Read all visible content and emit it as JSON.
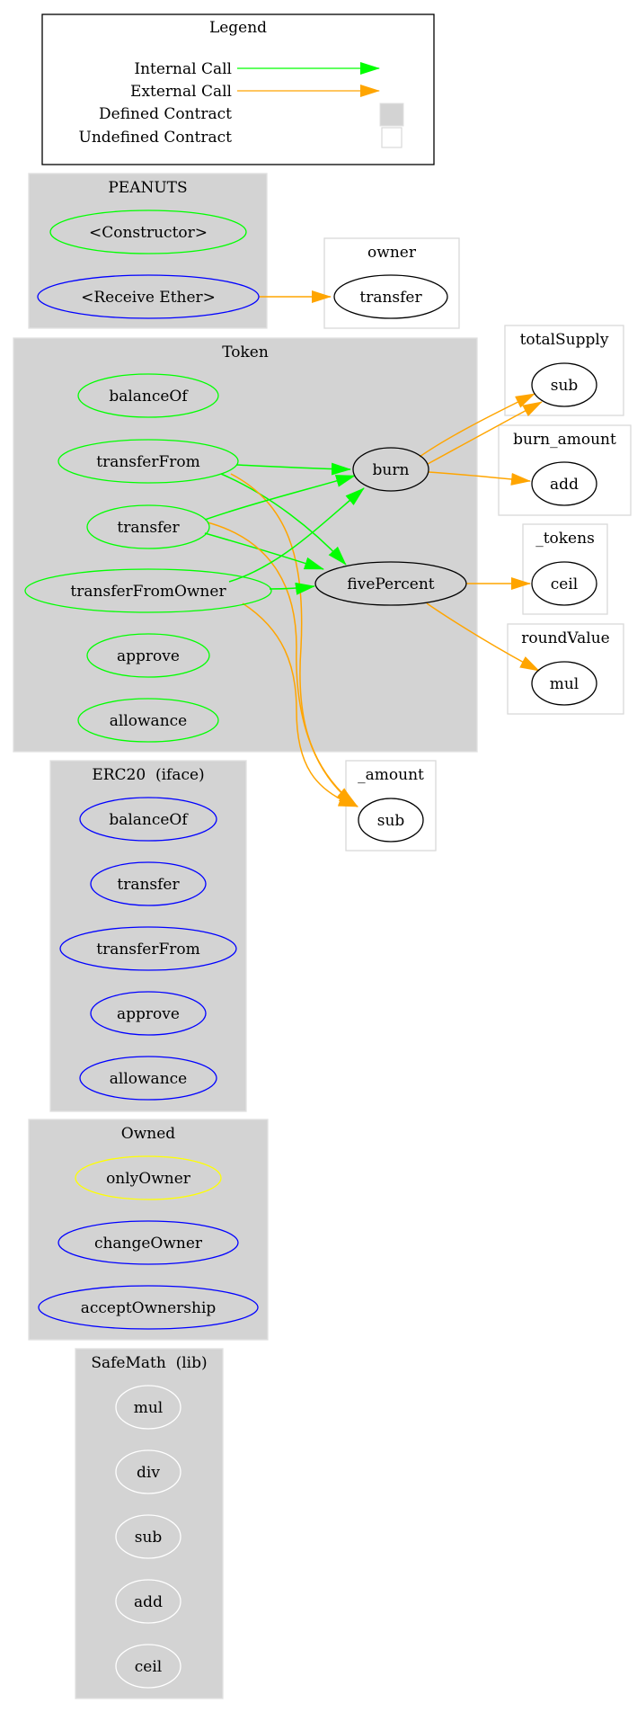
{
  "legend": {
    "title": "Legend",
    "rows": [
      {
        "label": "Internal Call",
        "kind": "edge",
        "color": "#00ff00"
      },
      {
        "label": "External Call",
        "kind": "edge",
        "color": "#ffa500"
      },
      {
        "label": "Defined Contract",
        "kind": "box",
        "fill": "#d3d3d3"
      },
      {
        "label": "Undefined Contract",
        "kind": "box",
        "fill": "#ffffff"
      }
    ]
  },
  "colors": {
    "internal_call": "#00ff00",
    "external_call": "#ffa500",
    "defined_contract_fill": "#d3d3d3",
    "undefined_contract_border": "#d9d9d9",
    "public_function": "#00ff00",
    "external_function": "#0000ff",
    "modifier": "#ffff00",
    "internal_function": "#000000",
    "library_function": "#ffffff"
  },
  "clusters": [
    {
      "id": "PEANUTS",
      "title": "PEANUTS",
      "defined": true,
      "nodes": [
        {
          "id": "PEANUTS.ctor",
          "label": "<Constructor>",
          "color": "#00ff00"
        },
        {
          "id": "PEANUTS.recv",
          "label": "<Receive Ether>",
          "color": "#0000ff"
        }
      ]
    },
    {
      "id": "owner",
      "title": "owner",
      "defined": false,
      "nodes": [
        {
          "id": "owner.transfer",
          "label": "transfer",
          "color": "#000000"
        }
      ]
    },
    {
      "id": "Token",
      "title": "Token",
      "defined": true,
      "nodes": [
        {
          "id": "Token.balanceOf",
          "label": "balanceOf",
          "color": "#00ff00"
        },
        {
          "id": "Token.transferFrom",
          "label": "transferFrom",
          "color": "#00ff00"
        },
        {
          "id": "Token.transfer",
          "label": "transfer",
          "color": "#00ff00"
        },
        {
          "id": "Token.transferFromOwner",
          "label": "transferFromOwner",
          "color": "#00ff00"
        },
        {
          "id": "Token.approve",
          "label": "approve",
          "color": "#00ff00"
        },
        {
          "id": "Token.allowance",
          "label": "allowance",
          "color": "#00ff00"
        },
        {
          "id": "Token.burn",
          "label": "burn",
          "color": "#000000"
        },
        {
          "id": "Token.fivePercent",
          "label": "fivePercent",
          "color": "#000000"
        }
      ]
    },
    {
      "id": "totalSupply",
      "title": "totalSupply",
      "defined": false,
      "nodes": [
        {
          "id": "totalSupply.sub",
          "label": "sub",
          "color": "#000000"
        }
      ]
    },
    {
      "id": "burn_amount",
      "title": "burn_amount",
      "defined": false,
      "nodes": [
        {
          "id": "burn_amount.add",
          "label": "add",
          "color": "#000000"
        }
      ]
    },
    {
      "id": "_tokens",
      "title": "_tokens",
      "defined": false,
      "nodes": [
        {
          "id": "_tokens.ceil",
          "label": "ceil",
          "color": "#000000"
        }
      ]
    },
    {
      "id": "roundValue",
      "title": "roundValue",
      "defined": false,
      "nodes": [
        {
          "id": "roundValue.mul",
          "label": "mul",
          "color": "#000000"
        }
      ]
    },
    {
      "id": "_amount",
      "title": "_amount",
      "defined": false,
      "nodes": [
        {
          "id": "_amount.sub",
          "label": "sub",
          "color": "#000000"
        }
      ]
    },
    {
      "id": "ERC20",
      "title": "ERC20  (iface)",
      "defined": true,
      "nodes": [
        {
          "id": "ERC20.balanceOf",
          "label": "balanceOf",
          "color": "#0000ff"
        },
        {
          "id": "ERC20.transfer",
          "label": "transfer",
          "color": "#0000ff"
        },
        {
          "id": "ERC20.transferFrom",
          "label": "transferFrom",
          "color": "#0000ff"
        },
        {
          "id": "ERC20.approve",
          "label": "approve",
          "color": "#0000ff"
        },
        {
          "id": "ERC20.allowance",
          "label": "allowance",
          "color": "#0000ff"
        }
      ]
    },
    {
      "id": "Owned",
      "title": "Owned",
      "defined": true,
      "nodes": [
        {
          "id": "Owned.onlyOwner",
          "label": "onlyOwner",
          "color": "#ffff00"
        },
        {
          "id": "Owned.changeOwner",
          "label": "changeOwner",
          "color": "#0000ff"
        },
        {
          "id": "Owned.acceptOwnership",
          "label": "acceptOwnership",
          "color": "#0000ff"
        }
      ]
    },
    {
      "id": "SafeMath",
      "title": "SafeMath  (lib)",
      "defined": true,
      "nodes": [
        {
          "id": "SafeMath.mul",
          "label": "mul",
          "color": "#ffffff"
        },
        {
          "id": "SafeMath.div",
          "label": "div",
          "color": "#ffffff"
        },
        {
          "id": "SafeMath.sub",
          "label": "sub",
          "color": "#ffffff"
        },
        {
          "id": "SafeMath.add",
          "label": "add",
          "color": "#ffffff"
        },
        {
          "id": "SafeMath.ceil",
          "label": "ceil",
          "color": "#ffffff"
        }
      ]
    }
  ],
  "edges": [
    {
      "from": "PEANUTS.recv",
      "to": "owner.transfer",
      "type": "external"
    },
    {
      "from": "Token.transferFrom",
      "to": "Token.burn",
      "type": "internal"
    },
    {
      "from": "Token.transferFrom",
      "to": "Token.fivePercent",
      "type": "internal"
    },
    {
      "from": "Token.transferFrom",
      "to": "_amount.sub",
      "type": "external"
    },
    {
      "from": "Token.transfer",
      "to": "Token.burn",
      "type": "internal"
    },
    {
      "from": "Token.transfer",
      "to": "Token.fivePercent",
      "type": "internal"
    },
    {
      "from": "Token.transfer",
      "to": "_amount.sub",
      "type": "external"
    },
    {
      "from": "Token.transferFromOwner",
      "to": "Token.burn",
      "type": "internal"
    },
    {
      "from": "Token.transferFromOwner",
      "to": "Token.fivePercent",
      "type": "internal"
    },
    {
      "from": "Token.transferFromOwner",
      "to": "_amount.sub",
      "type": "external"
    },
    {
      "from": "Token.burn",
      "to": "totalSupply.sub",
      "type": "external"
    },
    {
      "from": "Token.burn",
      "to": "totalSupply.sub",
      "type": "external"
    },
    {
      "from": "Token.burn",
      "to": "burn_amount.add",
      "type": "external"
    },
    {
      "from": "Token.fivePercent",
      "to": "_tokens.ceil",
      "type": "external"
    },
    {
      "from": "Token.fivePercent",
      "to": "roundValue.mul",
      "type": "external"
    }
  ]
}
